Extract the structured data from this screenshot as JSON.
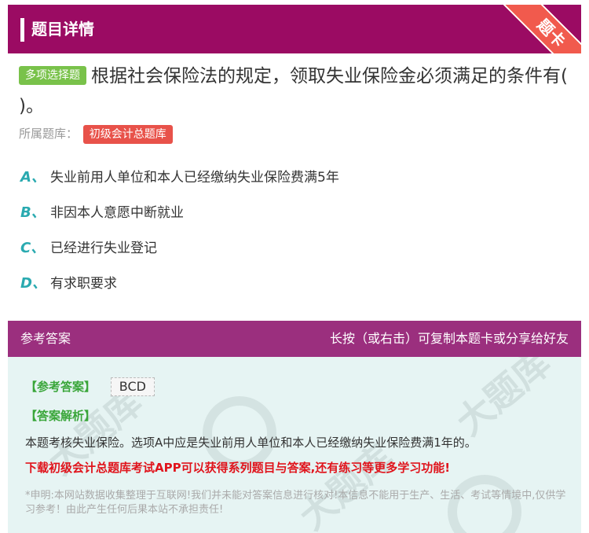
{
  "header": {
    "title": "题目详情",
    "corner_badge": "题卡"
  },
  "question": {
    "type_tag": "多项选择题",
    "text": "根据社会保险法的规定，领取失业保险金必须满足的条件有( )。",
    "bank_label": "所属题库：",
    "bank_name": "初级会计总题库"
  },
  "options": [
    {
      "letter": "A、",
      "text": "失业前用人单位和本人已经缴纳失业保险费满5年"
    },
    {
      "letter": "B、",
      "text": "非因本人意愿中断就业"
    },
    {
      "letter": "C、",
      "text": "已经进行失业登记"
    },
    {
      "letter": "D、",
      "text": "有求职要求"
    }
  ],
  "answer_section": {
    "title": "参考答案",
    "hint": "长按（或右击）可复制本题卡或分享给好友",
    "answer_label": "【参考答案】",
    "answer_value": "BCD",
    "analysis_label": "【答案解析】",
    "analysis_text": "本题考核失业保险。选项A中应是失业前用人单位和本人已经缴纳失业保险费满1年的。",
    "promo_text": "下载初级会计总题库考试APP可以获得系列题目与答案,还有练习等更多学习功能!",
    "disclaimer": "*申明:本网站数据收集整理于互联网!我们并未能对答案信息进行核对!本信息不能用于生产、生活、考试等情境中,仅供学习参考！由此产生任何后果本站不承担责任!"
  },
  "colors": {
    "header": "#9b0b63",
    "answer_header": "#9b2f7e",
    "accent": "#2aaab0",
    "answer_bg": "#e6f4f3"
  }
}
